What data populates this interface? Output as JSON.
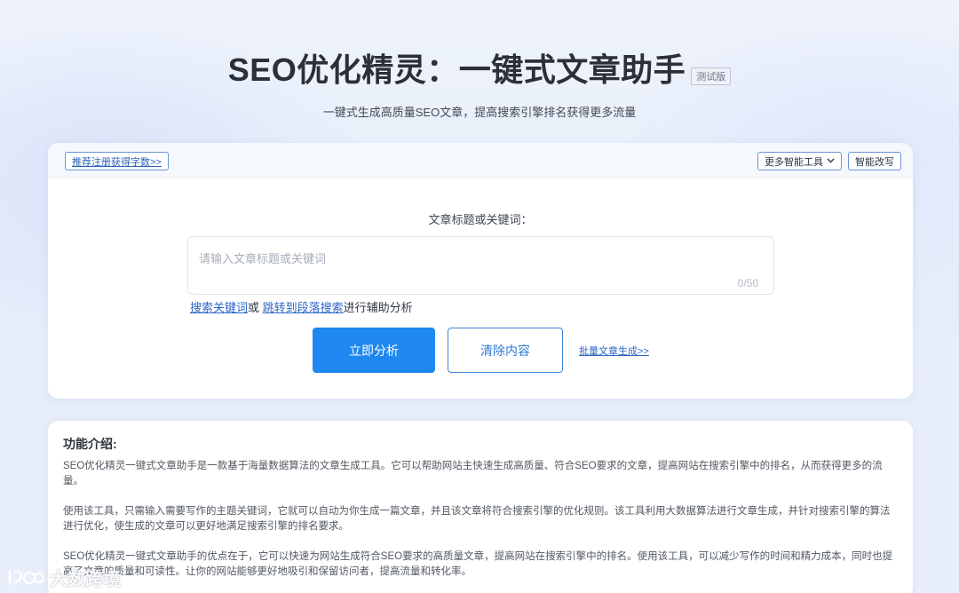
{
  "header": {
    "title": "SEO优化精灵：一键式文章助手",
    "beta_badge": "测试版",
    "subtitle": "一键式生成高质量SEO文章，提高搜索引擎排名获得更多流量"
  },
  "toolbar": {
    "register_link": "推荐注册获得字数>>",
    "more_tools": "更多智能工具",
    "smart_rewrite": "智能改写"
  },
  "form": {
    "label": "文章标题或关键词：",
    "placeholder": "请输入文章标题或关键词",
    "value": "",
    "char_count": "0/50",
    "helper_link_1": "搜索关键词",
    "helper_or": "或 ",
    "helper_link_2": "跳转到段落搜索",
    "helper_suffix": "进行辅助分析",
    "analyze_button": "立即分析",
    "clear_button": "清除内容",
    "batch_link": "批量文章生成>>"
  },
  "intro": {
    "heading": "功能介绍:",
    "paragraphs": [
      "SEO优化精灵一键式文章助手是一款基于海量数据算法的文章生成工具。它可以帮助网站主快速生成高质量、符合SEO要求的文章，提高网站在搜索引擎中的排名，从而获得更多的流量。",
      "使用该工具，只需输入需要写作的主题关键词，它就可以自动为你生成一篇文章，并且该文章将符合搜索引擎的优化规则。该工具利用大数据算法进行文章生成，并针对搜索引擎的算法进行优化，使生成的文章可以更好地满足搜索引擎的排名要求。",
      "SEO优化精灵一键式文章助手的优点在于，它可以快速为网站生成符合SEO要求的高质量文章，提高网站在搜索引擎中的排名。使用该工具，可以减少写作的时间和精力成本，同时也提高了文章的质量和可读性。让你的网站能够更好地吸引和保留访问者，提高流量和转化率。"
    ]
  },
  "watermark": {
    "text": "大数跨境"
  },
  "icons": {
    "dropdown": "chevron-down-icon",
    "watermark_logo": "brand-logo-icon"
  },
  "colors": {
    "primary": "#1f87f0",
    "link": "#2b65c5",
    "title": "#2b2f36"
  }
}
